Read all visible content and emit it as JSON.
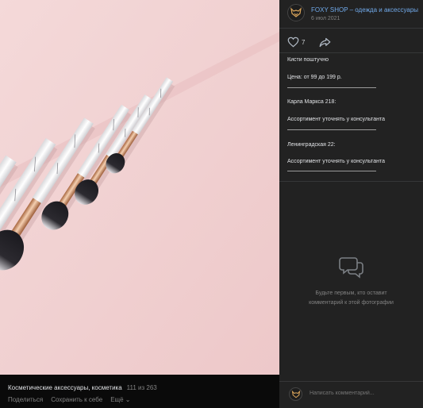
{
  "post": {
    "author_name": "FOXY SHOP – одежда и аксессуары",
    "date": "6 июл 2021",
    "like_count": "7",
    "description": [
      "Кисти поштучно",
      "Цена: от 99 до 199 р.",
      "Карла Маркса 218:",
      "Ассортимент уточнять у консультанта",
      "Ленинградская 22:",
      "Ассортимент уточнять у консультанта"
    ]
  },
  "album": {
    "name": "Косметические аксессуары, косметика",
    "counter": "111 из 263",
    "actions": {
      "share": "Поделиться",
      "save": "Сохранить к себе",
      "more": "Ещё ⌄"
    }
  },
  "comments": {
    "empty_text_line1": "Будьте первым, кто оставит",
    "empty_text_line2": "комментарий к этой фотографии",
    "placeholder": "Написать комментарий..."
  },
  "colors": {
    "panel_bg": "#222222",
    "link": "#71aaeb",
    "photo_bg": "#f0cfd0",
    "brush_ferrule": "#c6906d"
  },
  "icons": [
    "heart-icon",
    "share-arrow-icon",
    "comment-bubbles-icon",
    "fox-logo-icon"
  ]
}
